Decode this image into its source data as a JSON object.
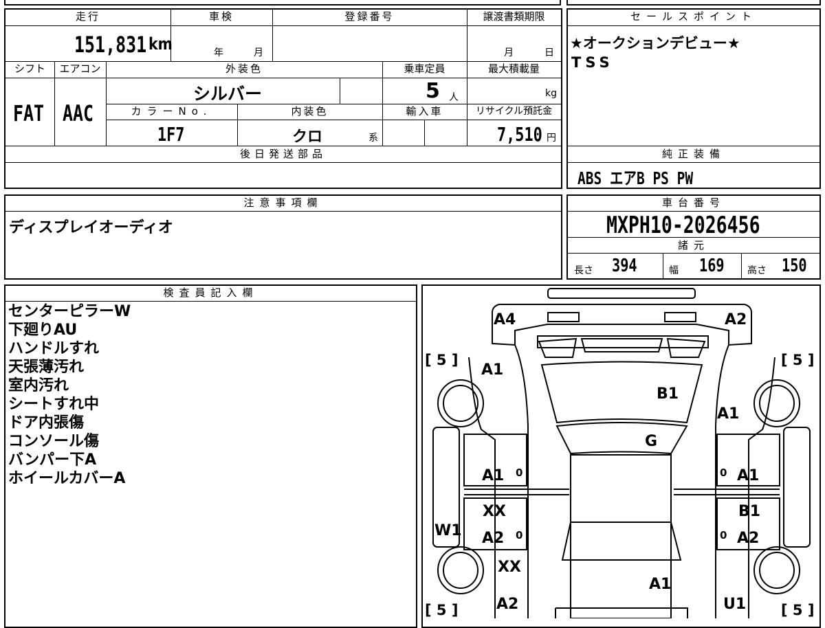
{
  "vehicle": {
    "mileage_label": "走行",
    "mileage": "151,831",
    "mileage_unit": "km",
    "shaken_label": "車検",
    "shaken_year_unit": "年",
    "shaken_month_unit": "月",
    "registration_label": "登録番号",
    "transfer_deadline_label": "譲渡書類期限",
    "transfer_month_unit": "月",
    "transfer_day_unit": "日",
    "shift_label": "シフト",
    "shift": "FAT",
    "aircon_label": "エアコン",
    "aircon": "AAC",
    "exterior_color_label": "外装色",
    "exterior_color": "シルバー",
    "capacity_label": "乗車定員",
    "capacity": "5",
    "capacity_unit": "人",
    "max_load_label": "最大積載量",
    "max_load_unit": "kg",
    "color_no_label": "カラーNo.",
    "color_no": "1F7",
    "interior_color_label": "内装色",
    "interior_color": "クロ",
    "interior_color_suffix": "系",
    "import_label": "輸入車",
    "recycle_label": "リサイクル預託金",
    "recycle_fee": "7,510",
    "recycle_unit": "円",
    "later_parts_label": "後日発送部品"
  },
  "sales_points": {
    "label": "セールスポイント",
    "lines": [
      "★オークションデビュー★",
      "TSS"
    ]
  },
  "genuine_equipment": {
    "label": "純正装備",
    "value": "ABS エアB PS PW"
  },
  "notes": {
    "label": "注意事項欄",
    "value": "ディスプレイオーディオ"
  },
  "chassis": {
    "label": "車台番号",
    "number": "MXPH10-2026456"
  },
  "specs": {
    "label": "諸元",
    "length_label": "長さ",
    "length": "394",
    "width_label": "幅",
    "width": "169",
    "height_label": "高さ",
    "height": "150"
  },
  "inspector": {
    "label": "検査員記入欄",
    "lines": [
      "センターピラーW",
      "下廻りAU",
      "ハンドルすれ",
      "天張薄汚れ",
      "室内汚れ",
      "シートすれ中",
      "ドア内張傷",
      "コンソール傷",
      "バンパー下A",
      "ホイールカバーA"
    ]
  },
  "diagram_marks": {
    "front_left_bumper": "A4",
    "front_right_bumper": "A2",
    "tire_front_left": "[ 5 ]",
    "tire_front_right": "[ 5 ]",
    "tire_rear_left": "[ 5 ]",
    "tire_rear_right": "[ 5 ]",
    "left_front_fender": "A1",
    "hood": "B1",
    "right_front_fender": "A1",
    "windshield": "G",
    "left_front_door": "A1",
    "right_front_door": "A1",
    "left_rear_door_1": "XX",
    "right_rear_door_1": "B1",
    "left_pillar": "W1",
    "left_rear_door_2": "A2",
    "right_rear_door_2": "A2",
    "left_rear_quarter": "XX",
    "roof": "A1",
    "left_rear_bumper": "A2",
    "right_rear_bumper": "U1",
    "door_mark": "0"
  }
}
